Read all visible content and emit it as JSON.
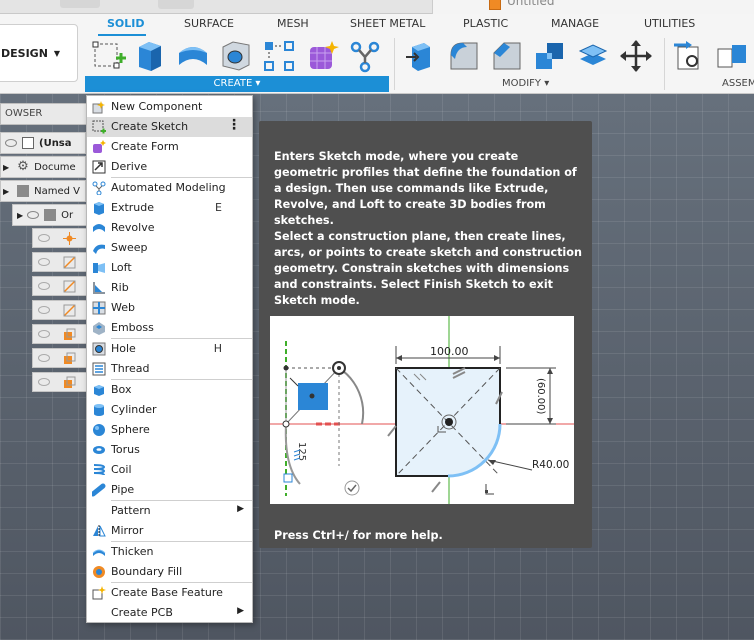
{
  "window": {
    "document_title": "Untitled"
  },
  "ribbon": {
    "workspace_label": "DESIGN",
    "tabs": [
      {
        "label": "SOLID",
        "active": true
      },
      {
        "label": "SURFACE"
      },
      {
        "label": "MESH"
      },
      {
        "label": "SHEET METAL"
      },
      {
        "label": "PLASTIC"
      },
      {
        "label": "MANAGE"
      },
      {
        "label": "UTILITIES"
      }
    ],
    "groups": {
      "create": "CREATE ▾",
      "modify": "MODIFY ▾",
      "assemble": "ASSEM"
    },
    "accent": "#1c8fd6"
  },
  "browser": {
    "header": "OWSER",
    "rows": [
      "(Unsa",
      "Docume",
      "Named V",
      "Or"
    ]
  },
  "menu": {
    "items": [
      {
        "label": "New Component",
        "icon": "new-component-icon"
      },
      {
        "label": "Create Sketch",
        "icon": "create-sketch-icon",
        "highlighted": true
      },
      {
        "label": "Create Form",
        "icon": "create-form-icon"
      },
      {
        "label": "Derive",
        "icon": "derive-icon"
      },
      {
        "label": "Automated Modeling",
        "icon": "automated-modeling-icon"
      },
      {
        "label": "Extrude",
        "icon": "extrude-icon",
        "shortcut": "E"
      },
      {
        "label": "Revolve",
        "icon": "revolve-icon"
      },
      {
        "label": "Sweep",
        "icon": "sweep-icon"
      },
      {
        "label": "Loft",
        "icon": "loft-icon"
      },
      {
        "label": "Rib",
        "icon": "rib-icon"
      },
      {
        "label": "Web",
        "icon": "web-icon"
      },
      {
        "label": "Emboss",
        "icon": "emboss-icon"
      },
      {
        "label": "Hole",
        "icon": "hole-icon",
        "shortcut": "H"
      },
      {
        "label": "Thread",
        "icon": "thread-icon"
      },
      {
        "label": "Box",
        "icon": "box-icon"
      },
      {
        "label": "Cylinder",
        "icon": "cylinder-icon"
      },
      {
        "label": "Sphere",
        "icon": "sphere-icon"
      },
      {
        "label": "Torus",
        "icon": "torus-icon"
      },
      {
        "label": "Coil",
        "icon": "coil-icon"
      },
      {
        "label": "Pipe",
        "icon": "pipe-icon"
      },
      {
        "label": "Pattern",
        "submenu": true
      },
      {
        "label": "Mirror",
        "icon": "mirror-icon"
      },
      {
        "label": "Thicken",
        "icon": "thicken-icon"
      },
      {
        "label": "Boundary Fill",
        "icon": "boundary-fill-icon"
      },
      {
        "label": "Create Base Feature",
        "icon": "base-feature-icon"
      },
      {
        "label": "Create PCB",
        "submenu": true
      }
    ]
  },
  "tooltip": {
    "paragraph1": "Enters Sketch mode, where you create geometric profiles that define the foundation of a design. Then use commands like Extrude, Revolve, and Loft to create 3D bodies from sketches.",
    "paragraph2": "Select a construction plane, then create lines, arcs, or points to create sketch and construction geometry. Constrain sketches with dimensions and constraints. Select Finish Sketch to exit Sketch mode.",
    "footer": "Press Ctrl+/ for more help.",
    "diagram": {
      "dim_width": "100.00",
      "dim_height": "(60.00)",
      "dim_radius": "R40.00",
      "dim_left": "125"
    }
  }
}
